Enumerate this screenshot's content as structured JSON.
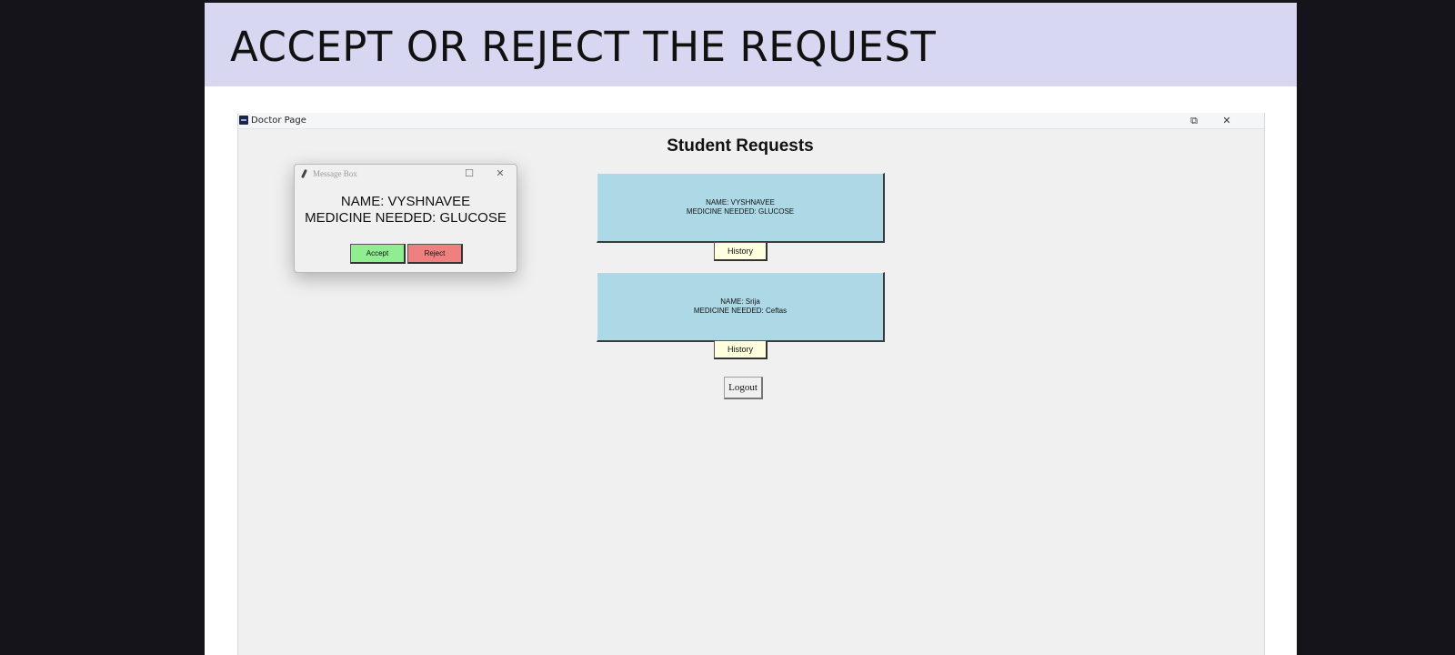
{
  "slide": {
    "title": "ACCEPT OR REJECT THE REQUEST"
  },
  "window": {
    "title": "Doctor Page",
    "restore_glyph": "⧉",
    "close_glyph": "✕"
  },
  "page": {
    "heading": "Student Requests",
    "requests": [
      {
        "name_line": "NAME: VYSHNAVEE",
        "medicine_line": "MEDICINE NEEDED: GLUCOSE",
        "history_label": "History"
      },
      {
        "name_line": "NAME: Srija",
        "medicine_line": "MEDICINE NEEDED: Ceftas",
        "history_label": "History"
      }
    ],
    "logout_label": "Logout"
  },
  "message_box": {
    "title": "Message Box",
    "maximize_glyph": "☐",
    "close_glyph": "✕",
    "name_line": "NAME: VYSHNAVEE",
    "medicine_line": "MEDICINE NEEDED: GLUCOSE",
    "accept_label": "Accept",
    "reject_label": "Reject"
  },
  "colors": {
    "slide_header_bg": "#d8d7f1",
    "request_card_bg": "#add8e6",
    "history_button_bg": "#ffffe0",
    "accept_button_bg": "#90ee90",
    "reject_button_bg": "#f08080"
  }
}
